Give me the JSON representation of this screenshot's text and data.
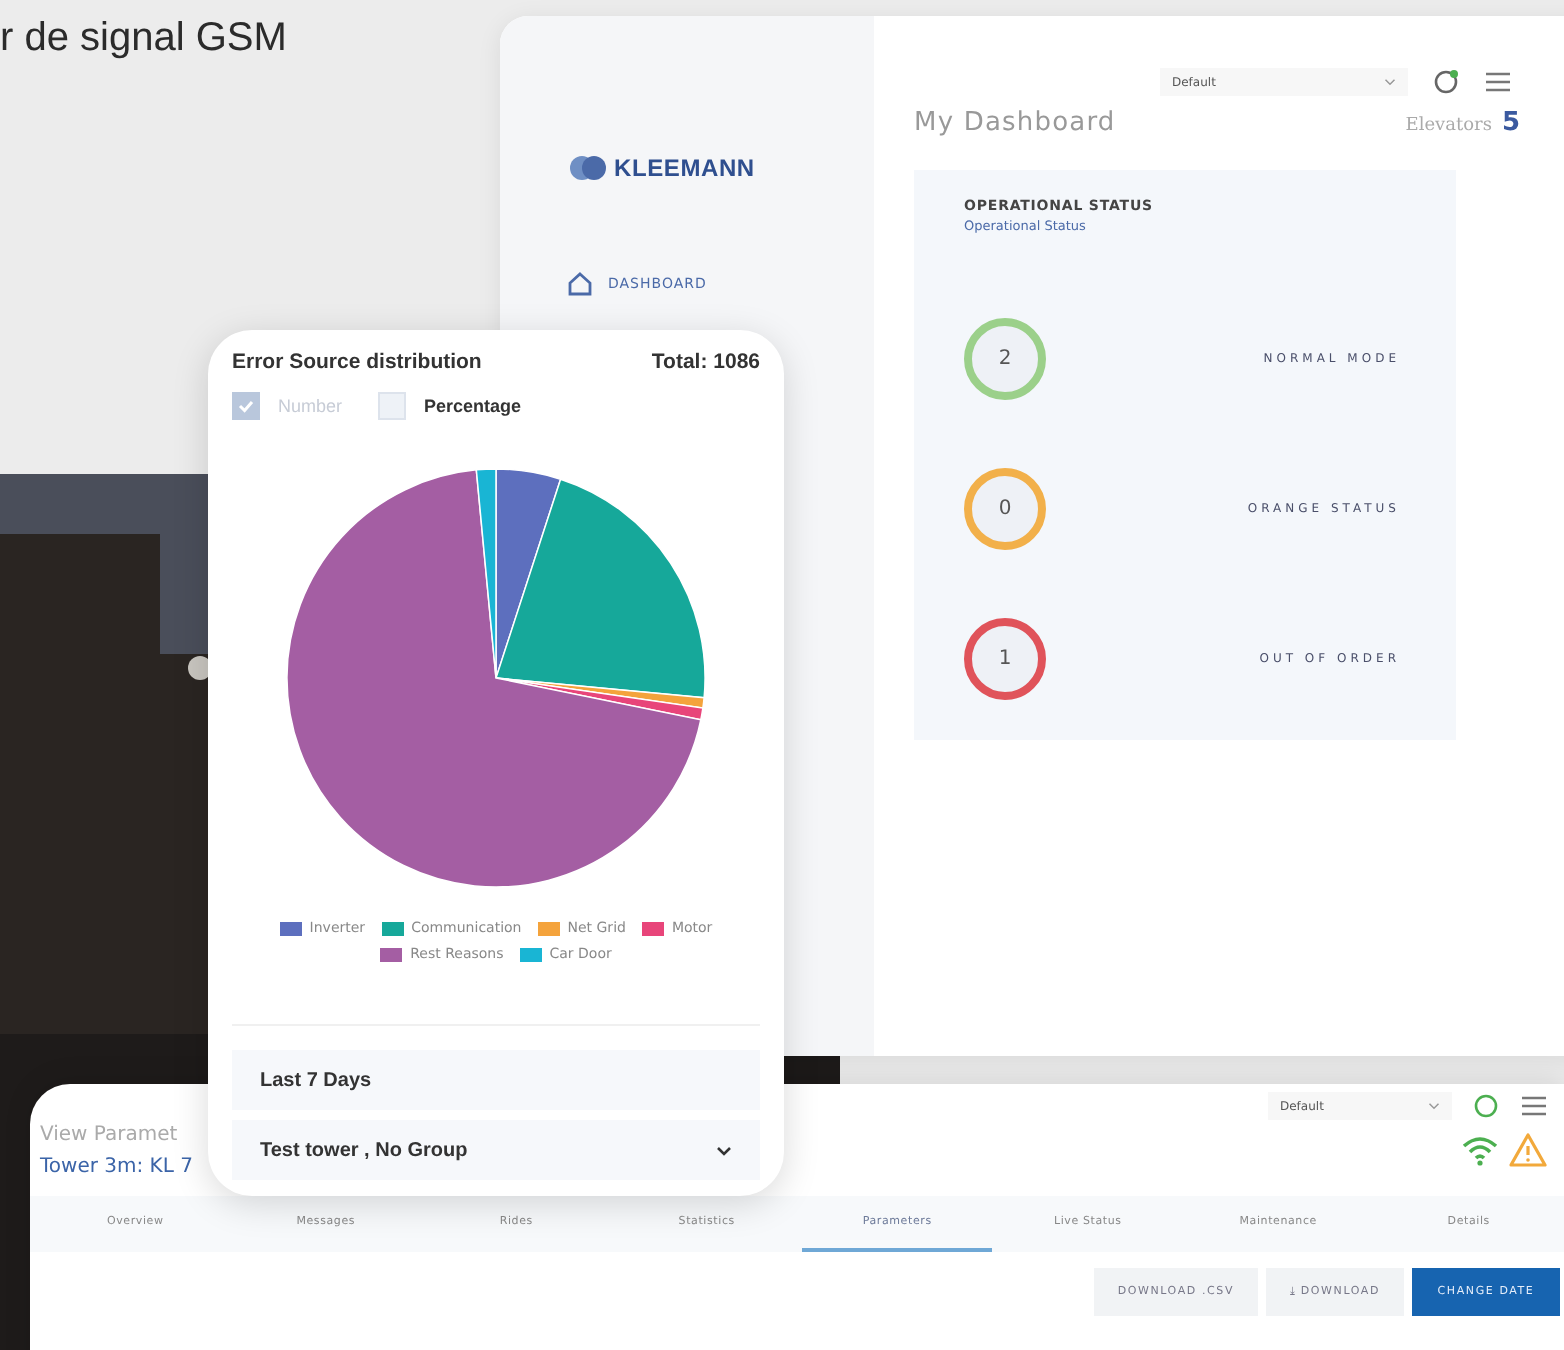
{
  "caption": "r de signal GSM",
  "dashboard": {
    "logo": "KLEEMANN",
    "nav": [
      {
        "label": "DASHBOARD"
      }
    ],
    "view_select": "Default",
    "title": "My Dashboard",
    "elevators_label": "Elevators",
    "elevators_count": "5",
    "status_panel": {
      "title": "OPERATIONAL STATUS",
      "subtitle": "Operational Status",
      "items": [
        {
          "count": "2",
          "label": "NORMAL MODE",
          "color": "#9bd08a"
        },
        {
          "count": "0",
          "label": "ORANGE STATUS",
          "color": "#f2b04a"
        },
        {
          "count": "1",
          "label": "OUT OF ORDER",
          "color": "#e0535a"
        }
      ]
    }
  },
  "chart_card": {
    "title": "Error Source distribution",
    "total": "Total: 1086",
    "options": [
      {
        "label": "Number",
        "checked": true
      },
      {
        "label": "Percentage",
        "checked": false
      }
    ],
    "legend": [
      {
        "label": "Inverter",
        "color": "#5d6fbe"
      },
      {
        "label": "Communication",
        "color": "#16a89a"
      },
      {
        "label": "Net Grid",
        "color": "#f4a33c"
      },
      {
        "label": "Motor",
        "color": "#e8457a"
      },
      {
        "label": "Rest Reasons",
        "color": "#a45ea3"
      },
      {
        "label": "Car Door",
        "color": "#19b5d4"
      }
    ],
    "period": "Last 7 Days",
    "group_select": "Test tower , No Group"
  },
  "detail": {
    "title": "View Paramet",
    "subtitle": "Tower 3m: KL 7",
    "view_select": "Default",
    "tabs": [
      {
        "label": "Overview",
        "selected": false
      },
      {
        "label": "Messages",
        "selected": false
      },
      {
        "label": "Rides",
        "selected": false
      },
      {
        "label": "Statistics",
        "selected": false
      },
      {
        "label": "Parameters",
        "selected": true
      },
      {
        "label": "Live Status",
        "selected": false
      },
      {
        "label": "Maintenance",
        "selected": false
      },
      {
        "label": "Details",
        "selected": false
      }
    ],
    "buttons": [
      {
        "label": "DOWNLOAD .CSV",
        "kind": "plain"
      },
      {
        "label": "⤓ DOWNLOAD",
        "kind": "plain"
      },
      {
        "label": "CHANGE DATE",
        "kind": "primary"
      }
    ]
  }
}
